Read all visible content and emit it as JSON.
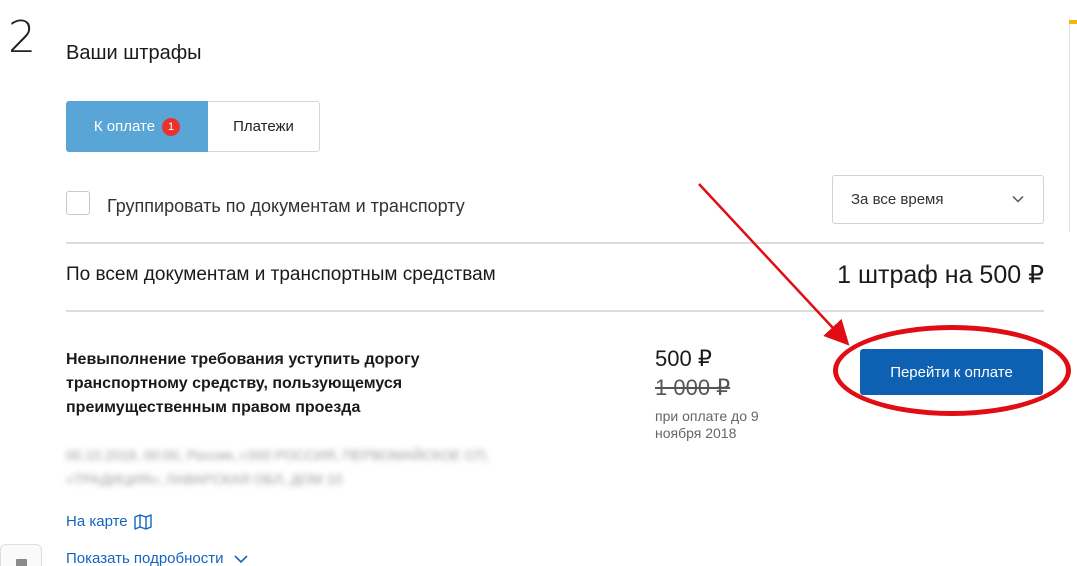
{
  "step_number": "2",
  "page_title": "Ваши штрафы",
  "tabs": [
    {
      "label": "К оплате",
      "badge": "1",
      "active": true
    },
    {
      "label": "Платежи",
      "active": false
    }
  ],
  "group_checkbox": {
    "label": "Группировать по документам и транспорту",
    "checked": false
  },
  "period_select": {
    "value": "За все время"
  },
  "summary": {
    "label": "По всем документам и транспортным средствам",
    "total": "1 штраф на 500 ₽"
  },
  "fine": {
    "description": "Невыполнение требования уступить дорогу транспортному средству, пользующемуся преимущественным правом проезда",
    "price": "500 ₽",
    "old_price": "1 000 ₽",
    "pay_until": "при оплате до 9 ноября 2018",
    "pay_button": "Перейти к оплате",
    "location_blurred": "00.10.2018, 00:00, Россия, г.000 РОССИЯ, ПЕРВОМАЙСКОЕ СП, «ТРАДИЦИЯ»; ЛАВАРСКАЯ ОБЛ, ДОМ 10",
    "map_link": "На карте",
    "details_link": "Показать подробности"
  },
  "colors": {
    "tab_active_bg": "#59a6d6",
    "badge_bg": "#e8322f",
    "pay_button_bg": "#0d60b2",
    "link": "#1565c0",
    "annotation_red": "#e00d14"
  },
  "icons": [
    "chevron-down-icon",
    "map-icon",
    "red-arrow-annotation",
    "red-oval-annotation"
  ]
}
